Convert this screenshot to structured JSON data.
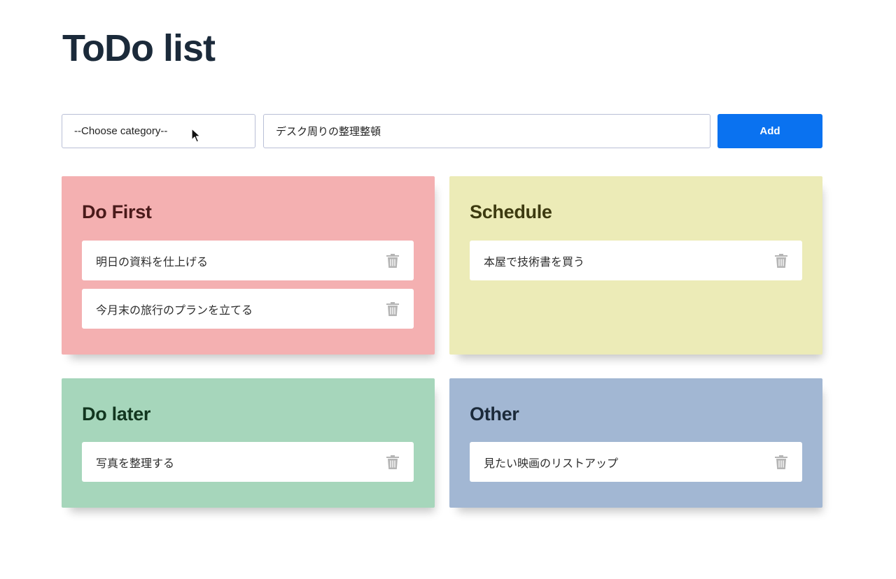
{
  "title": "ToDo list",
  "form": {
    "category_select_value": "--Choose category--",
    "task_input_value": "デスク周りの整理整頓",
    "add_label": "Add"
  },
  "panels": [
    {
      "title": "Do First",
      "bg_color": "#f4b0b1",
      "title_color": "#4a1a1a",
      "items": [
        "明日の資料を仕上げる",
        "今月末の旅行のプランを立てる"
      ]
    },
    {
      "title": "Schedule",
      "bg_color": "#ecebb7",
      "title_color": "#3d3a10",
      "items": [
        "本屋で技術書を買う"
      ]
    },
    {
      "title": "Do later",
      "bg_color": "#a6d6bb",
      "title_color": "#12361f",
      "items": [
        "写真を整理する"
      ]
    },
    {
      "title": "Other",
      "bg_color": "#a2b7d3",
      "title_color": "#1b2a3a",
      "items": [
        "見たい映画のリストアップ"
      ]
    }
  ],
  "colors": {
    "accent": "#0a72f0",
    "title": "#1b2a3a",
    "input_border": "#b9bfd6",
    "trash_icon": "#b5b5b5"
  },
  "icons": {
    "delete": "trash-icon",
    "pointer": "mouse-cursor-icon"
  }
}
